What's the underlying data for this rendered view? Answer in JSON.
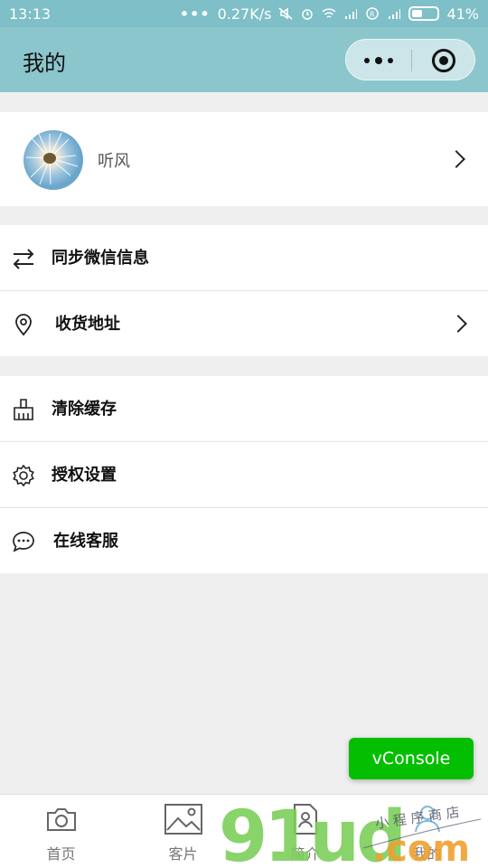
{
  "status_bar": {
    "time": "13:13",
    "dots": "•••",
    "speed": "0.27K/s",
    "battery": "41%",
    "battery_level": 0.41
  },
  "navbar": {
    "title": "我的"
  },
  "profile": {
    "nickname": "听风"
  },
  "menu": [
    {
      "label": "同步微信信息",
      "icon": "sync-arrows-icon"
    },
    {
      "label": "收货地址",
      "icon": "location-pin-icon"
    },
    {
      "label": "清除缓存",
      "icon": "broom-icon"
    },
    {
      "label": "授权设置",
      "icon": "gear-icon"
    },
    {
      "label": "在线客服",
      "icon": "chat-bubble-icon"
    }
  ],
  "vconsole": {
    "label": "vConsole"
  },
  "tabbar": {
    "items": [
      {
        "label": "首页",
        "icon": "camera-icon"
      },
      {
        "label": "客片",
        "icon": "picture-icon"
      },
      {
        "label": "简介",
        "icon": "document-icon"
      },
      {
        "label": "我的",
        "icon": "person-icon"
      }
    ]
  },
  "watermark": {
    "text": "91ud.com",
    "tagline": "小程序商店"
  },
  "colors": {
    "navbar": "#8cc6cd",
    "vconsole": "#04be02",
    "watermark_green": "#7ccf5a",
    "watermark_orange": "#f0a030"
  }
}
